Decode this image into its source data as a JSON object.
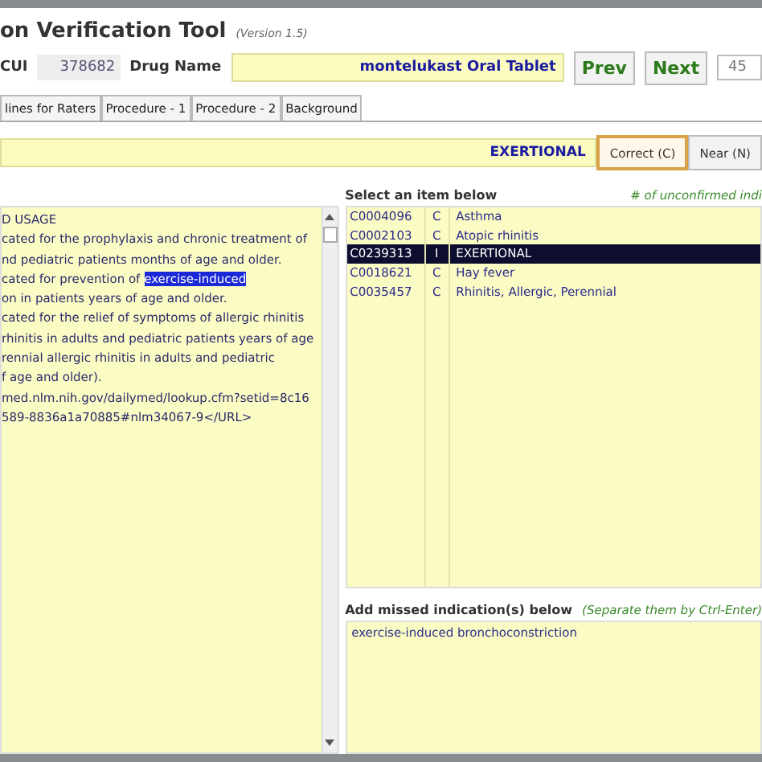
{
  "window": {
    "title": "on Verification Tool",
    "version": "(Version 1.5)"
  },
  "header": {
    "cui_label": "CUI",
    "cui_value": "378682",
    "drug_label": "Drug Name",
    "drug_value": "montelukast Oral Tablet",
    "prev": "Prev",
    "next": "Next",
    "counter": "45"
  },
  "tabs": [
    "lines for Raters",
    "Procedure - 1",
    "Procedure - 2",
    "Background"
  ],
  "term": {
    "value": "EXERTIONAL",
    "buttons": [
      {
        "label": "Correct (C)",
        "selected": true
      },
      {
        "label": "Near (N)",
        "selected": false
      }
    ]
  },
  "label_text": [
    {
      "text": "D USAGE"
    },
    {
      "text": "cated for the prophylaxis and chronic treatment of"
    },
    {
      "text": "nd pediatric patients months of age and older."
    },
    {
      "text": "cated for prevention of ",
      "highlight": "exercise-induced"
    },
    {
      "text": "on in patients years of age and older."
    },
    {
      "text": "cated for the relief of symptoms of allergic rhinitis"
    },
    {
      "text": " rhinitis in adults and pediatric patients years of age"
    },
    {
      "text": "rennial allergic rhinitis in adults and pediatric"
    },
    {
      "text": "f age and older)."
    },
    {
      "text": "med.nlm.nih.gov/dailymed/lookup.cfm?setid=8c16"
    },
    {
      "text": "589-8836a1a70885#nlm34067-9</URL>"
    }
  ],
  "select_label": "Select an item below",
  "unconfirmed_label": "# of unconfirmed indi",
  "items": [
    {
      "code": "C0004096",
      "flag": "C",
      "name": "Asthma",
      "selected": false
    },
    {
      "code": "C0002103",
      "flag": "C",
      "name": "Atopic rhinitis",
      "selected": false
    },
    {
      "code": "C0239313",
      "flag": "I",
      "name": "EXERTIONAL",
      "selected": true
    },
    {
      "code": "C0018621",
      "flag": "C",
      "name": "Hay fever",
      "selected": false
    },
    {
      "code": "C0035457",
      "flag": "C",
      "name": "Rhinitis, Allergic, Perennial",
      "selected": false
    }
  ],
  "missed": {
    "label": "Add missed indication(s) below",
    "hint": "(Separate them by Ctrl-Enter)",
    "value": "exercise-induced bronchoconstriction"
  }
}
